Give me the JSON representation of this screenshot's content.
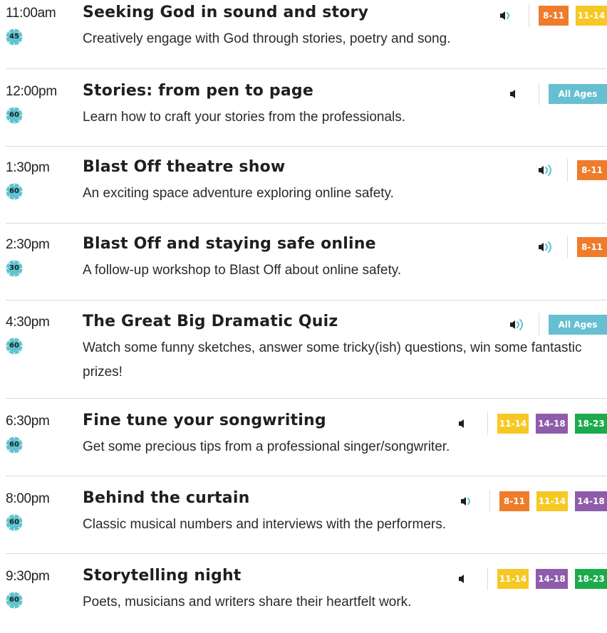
{
  "colors": {
    "orange": "#ee7c2b",
    "yellow": "#f7c823",
    "purple": "#8f5bab",
    "green": "#1bab4c",
    "teal": "#66c0d1",
    "duration_icon": "#5fc4cf"
  },
  "events": [
    {
      "time": "11:00am",
      "duration": "45",
      "title": "Seeking God in sound and story",
      "description": "Creatively engage with God through stories, poetry and song.",
      "sound_level": "medium",
      "badges": [
        {
          "label": "8-11",
          "color": "#ee7c2b"
        },
        {
          "label": "11-14",
          "color": "#f7c823"
        }
      ]
    },
    {
      "time": "12:00pm",
      "duration": "60",
      "title": "Stories: from pen to page",
      "description": "Learn how to craft your stories from the professionals.",
      "sound_level": "low",
      "badges": [
        {
          "label": "All Ages",
          "color": "#66c0d1"
        }
      ]
    },
    {
      "time": "1:30pm",
      "duration": "60",
      "title": "Blast Off theatre show",
      "description": "An exciting space adventure exploring online safety.",
      "sound_level": "high",
      "badges": [
        {
          "label": "8-11",
          "color": "#ee7c2b"
        }
      ]
    },
    {
      "time": "2:30pm",
      "duration": "30",
      "title": "Blast Off and staying safe online",
      "description": "A follow-up workshop to Blast Off about online safety.",
      "sound_level": "high",
      "badges": [
        {
          "label": "8-11",
          "color": "#ee7c2b"
        }
      ]
    },
    {
      "time": "4:30pm",
      "duration": "60",
      "title": "The Great Big Dramatic Quiz",
      "description": "Watch some funny sketches, answer some tricky(ish) questions, win some fantastic prizes!",
      "sound_level": "high",
      "badges": [
        {
          "label": "All Ages",
          "color": "#66c0d1"
        }
      ]
    },
    {
      "time": "6:30pm",
      "duration": "60",
      "title": "Fine tune your songwriting",
      "description": "Get some precious tips from a professional singer/songwriter.",
      "sound_level": "low",
      "badges": [
        {
          "label": "11-14",
          "color": "#f7c823"
        },
        {
          "label": "14-18",
          "color": "#8f5bab"
        },
        {
          "label": "18-23",
          "color": "#1bab4c"
        }
      ]
    },
    {
      "time": "8:00pm",
      "duration": "60",
      "title": "Behind the curtain",
      "description": "Classic musical numbers and interviews with the performers.",
      "sound_level": "medium",
      "badges": [
        {
          "label": "8-11",
          "color": "#ee7c2b"
        },
        {
          "label": "11-14",
          "color": "#f7c823"
        },
        {
          "label": "14-18",
          "color": "#8f5bab"
        }
      ]
    },
    {
      "time": "9:30pm",
      "duration": "60",
      "title": "Storytelling night",
      "description": "Poets, musicians and writers share their heartfelt work.",
      "sound_level": "low",
      "badges": [
        {
          "label": "11-14",
          "color": "#f7c823"
        },
        {
          "label": "14-18",
          "color": "#8f5bab"
        },
        {
          "label": "18-23",
          "color": "#1bab4c"
        }
      ]
    }
  ]
}
